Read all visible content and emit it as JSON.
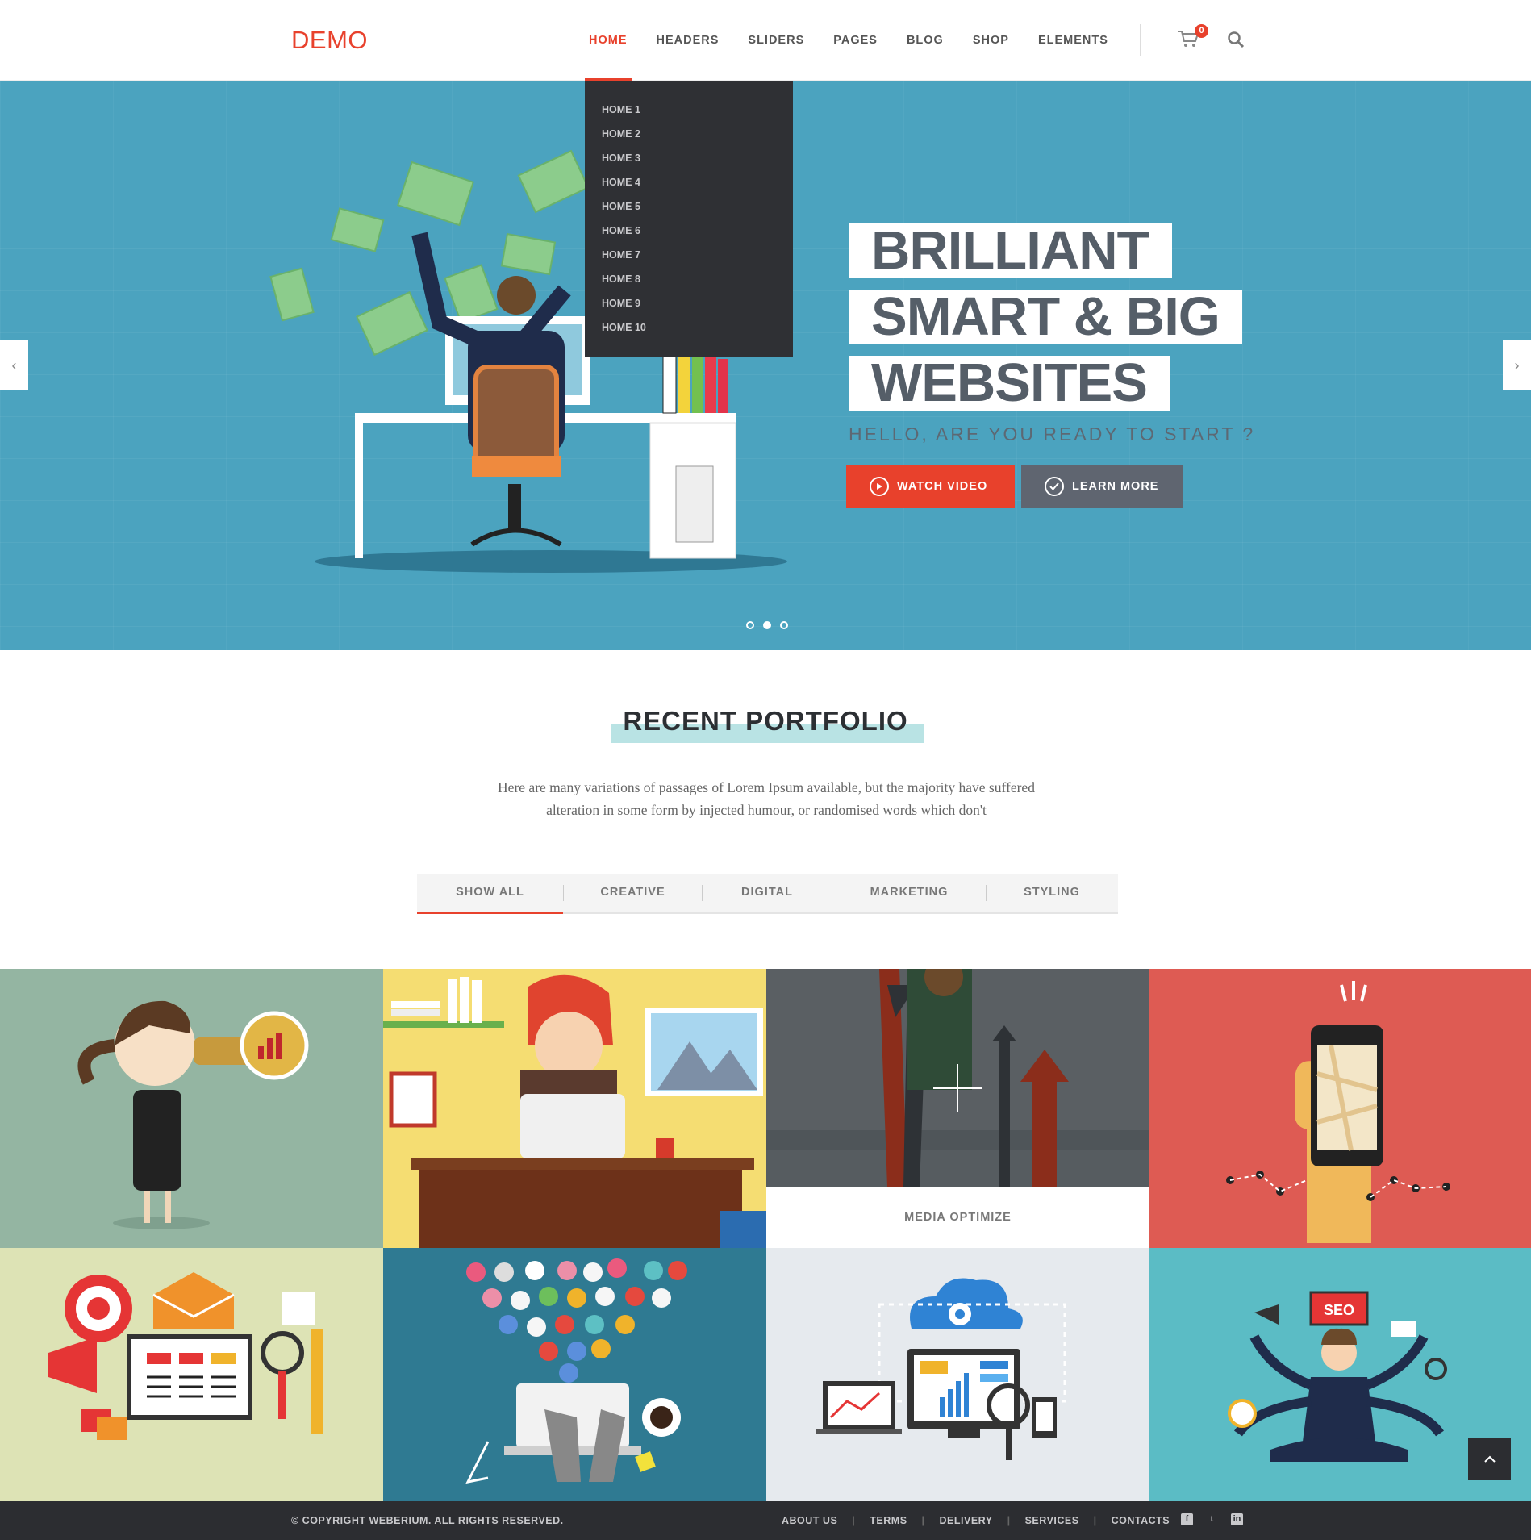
{
  "brand": {
    "logo": "DEMO",
    "accent": "#e8412c"
  },
  "nav": {
    "items": [
      "HOME",
      "HEADERS",
      "SLIDERS",
      "PAGES",
      "BLOG",
      "SHOP",
      "ELEMENTS"
    ],
    "cart_count": "0"
  },
  "dropdown": {
    "items": [
      "HOME 1",
      "HOME 2",
      "HOME 3",
      "HOME 4",
      "HOME 5",
      "HOME 6",
      "HOME 7",
      "HOME 8",
      "HOME 9",
      "HOME 10"
    ]
  },
  "hero": {
    "line1": "BRILLIANT",
    "line2": "SMART & BIG",
    "line3": "WEBSITES",
    "subtitle": "HELLO, ARE YOU READY TO START ?",
    "watch_label": "WATCH VIDEO",
    "learn_label": "LEARN MORE",
    "active_slide": 2,
    "slide_count": 3,
    "bg_color": "#4ba3bf"
  },
  "portfolio": {
    "title": "RECENT PORTFOLIO",
    "description": "Here are many variations of passages of Lorem Ipsum available, but the majority have suffered alteration in some form by injected humour, or randomised words which don't",
    "filters": [
      "SHOW ALL",
      "CREATIVE",
      "DIGITAL",
      "MARKETING",
      "STYLING"
    ],
    "hover_caption": "MEDIA OPTIMIZE",
    "tile_colors": [
      "#94b5a2",
      "#f5dd72",
      "#5a5f63",
      "#de5b53",
      "#dde3b5",
      "#2f7a92",
      "#e6eaee",
      "#5bbcc5"
    ]
  },
  "footer": {
    "copyright": "© COPYRIGHT WEBERIUM. ALL RIGHTS RESERVED.",
    "links": [
      "ABOUT US",
      "TERMS",
      "DELIVERY",
      "SERVICES",
      "CONTACTS"
    ]
  }
}
